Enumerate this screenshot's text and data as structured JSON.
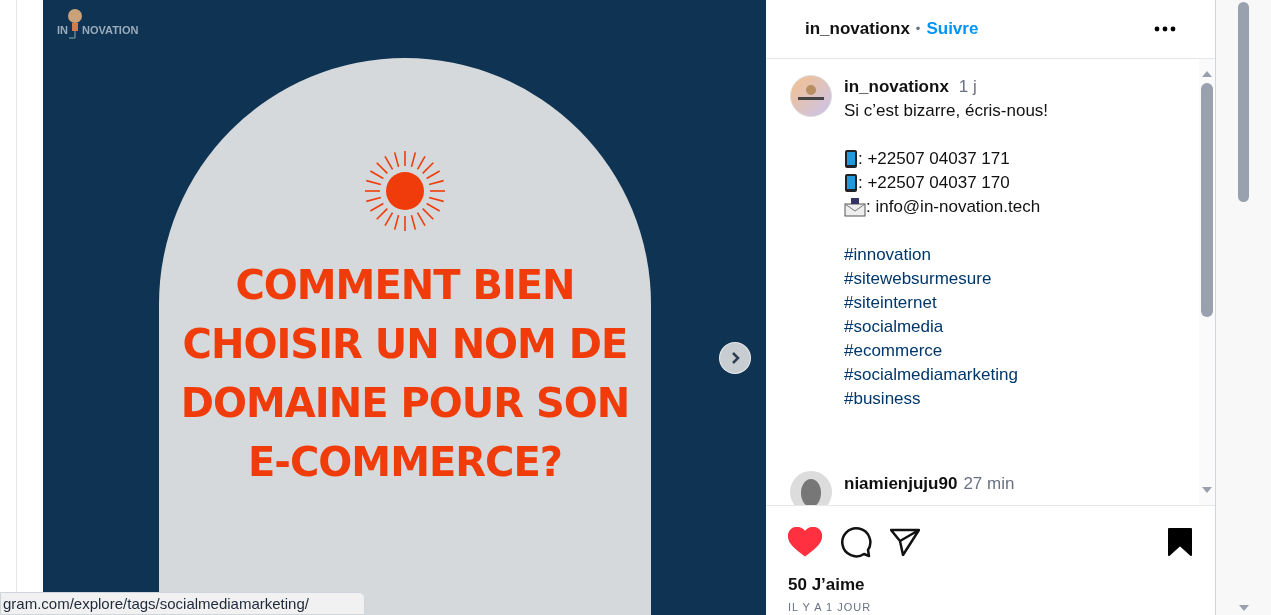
{
  "post_image": {
    "logo_left": "IN",
    "logo_right": "NOVATION",
    "headline_lines": [
      "COMMENT BIEN",
      "CHOISIR UN NOM DE",
      "DOMAINE POUR SON",
      "E-COMMERCE?"
    ]
  },
  "header": {
    "username": "in_novationx",
    "separator": "•",
    "follow": "Suivre"
  },
  "caption": {
    "username": "in_novationx",
    "time": "1 j",
    "lines": [
      {
        "kind": "text",
        "text": "Si c’est bizarre, écris-nous!"
      },
      {
        "kind": "blank"
      },
      {
        "kind": "phone",
        "text": ": +22507 04037 171"
      },
      {
        "kind": "phone",
        "text": ": +22507 04037 170"
      },
      {
        "kind": "mail",
        "text": ": info@in-novation.tech"
      },
      {
        "kind": "blank"
      },
      {
        "kind": "hashtag",
        "text": "#innovation"
      },
      {
        "kind": "hashtag",
        "text": "#sitewebsurmesure"
      },
      {
        "kind": "hashtag",
        "text": "#siteinternet"
      },
      {
        "kind": "hashtag",
        "text": "#socialmedia"
      },
      {
        "kind": "hashtag",
        "text": "#ecommerce"
      },
      {
        "kind": "hashtag",
        "text": "#socialmediamarketing"
      },
      {
        "kind": "hashtag",
        "text": "#business"
      }
    ]
  },
  "comments": [
    {
      "username": "niamienjuju90",
      "time": "27 min"
    }
  ],
  "actions": {
    "liked": true,
    "saved": true,
    "likes": "50 J’aime",
    "date": "IL Y A 1 JOUR"
  },
  "status_url": "gram.com/explore/tags/socialmediamarketing/"
}
